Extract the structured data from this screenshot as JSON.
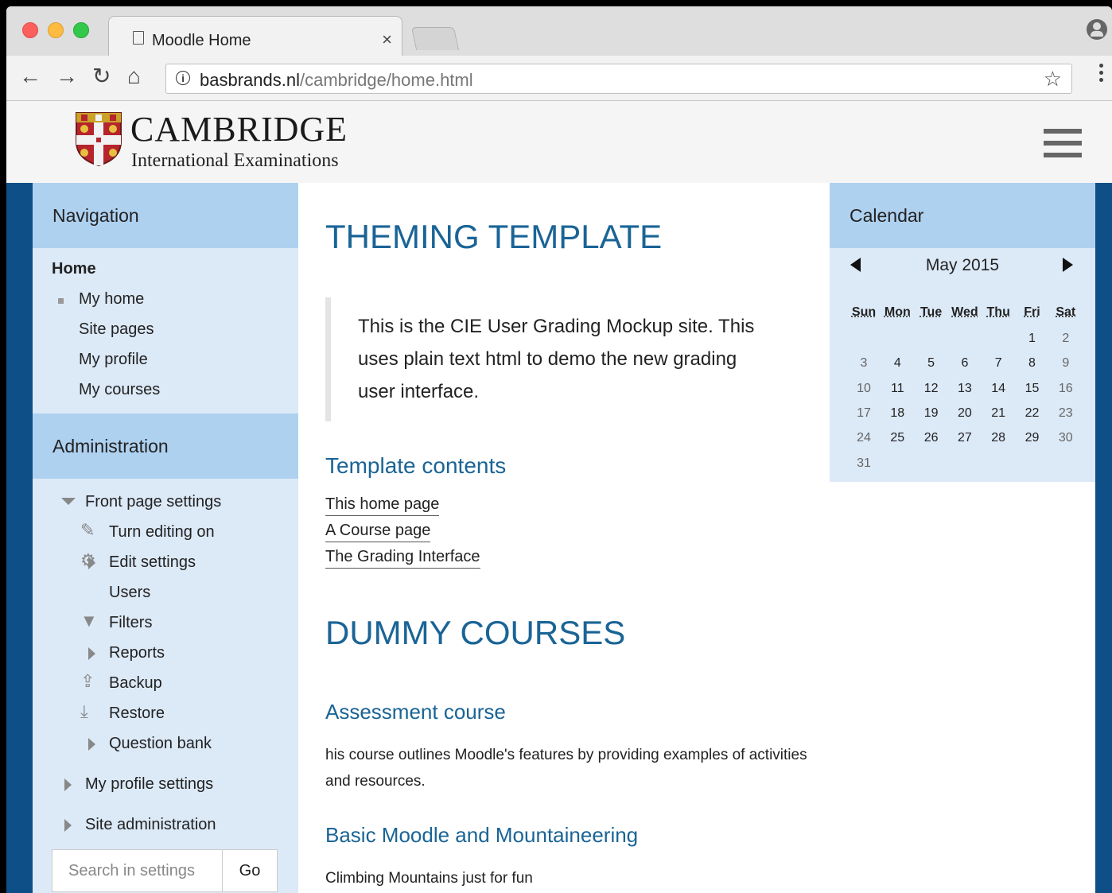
{
  "browser": {
    "tab_title": "Moodle Home",
    "tab_close": "×",
    "url_host": "basbrands.nl",
    "url_path": "/cambridge/home.html",
    "info_glyph": "i",
    "back": "←",
    "forward": "→",
    "reload": "↻",
    "home": "⌂",
    "star": "☆"
  },
  "brand": {
    "main": "CAMBRIDGE",
    "sub": "International Examinations"
  },
  "navigation": {
    "title": "Navigation",
    "home": "Home",
    "items": [
      "My home",
      "Site pages",
      "My profile",
      "My courses"
    ]
  },
  "administration": {
    "title": "Administration",
    "front_page_settings": "Front page settings",
    "items": [
      "Turn editing on",
      "Edit settings",
      "Users",
      "Filters",
      "Reports",
      "Backup",
      "Restore",
      "Question bank"
    ],
    "my_profile_settings": "My profile settings",
    "site_administration": "Site administration",
    "search_placeholder": "Search in settings",
    "go": "Go"
  },
  "main": {
    "title": "THEMING TEMPLATE",
    "quote": "This is the CIE User Grading Mockup site. This uses plain text html to demo the new grading user interface.",
    "contents_heading": "Template contents",
    "links": [
      "This home page",
      "A Course page",
      "The Grading Interface"
    ],
    "courses_heading": "DUMMY COURSES",
    "course1_title": "Assessment course",
    "course1_desc": "his course outlines Moodle's features by providing examples of activities and resources.",
    "course2_title": "Basic Moodle and Mountaineering",
    "course2_desc": "Climbing Mountains just for fun"
  },
  "calendar": {
    "title": "Calendar",
    "month": "May 2015",
    "weekdays": [
      "Sun",
      "Mon",
      "Tue",
      "Wed",
      "Thu",
      "Fri",
      "Sat"
    ],
    "weeks": [
      [
        "",
        "",
        "",
        "",
        "",
        "1",
        "2"
      ],
      [
        "3",
        "4",
        "5",
        "6",
        "7",
        "8",
        "9"
      ],
      [
        "10",
        "11",
        "12",
        "13",
        "14",
        "15",
        "16"
      ],
      [
        "17",
        "18",
        "19",
        "20",
        "21",
        "22",
        "23"
      ],
      [
        "24",
        "25",
        "26",
        "27",
        "28",
        "29",
        "30"
      ],
      [
        "31",
        "",
        "",
        "",
        "",
        "",
        ""
      ]
    ]
  },
  "colors": {
    "page_bg": "#0f4f87",
    "block_header": "#afd1f0",
    "block_body": "#dce9f7",
    "heading": "#1a6496"
  },
  "icons": [
    "page-icon",
    "info-icon",
    "star-icon",
    "profile-icon",
    "hamburger-icon",
    "pencil-icon",
    "gear-icon",
    "filter-icon",
    "backup-icon",
    "restore-icon"
  ]
}
